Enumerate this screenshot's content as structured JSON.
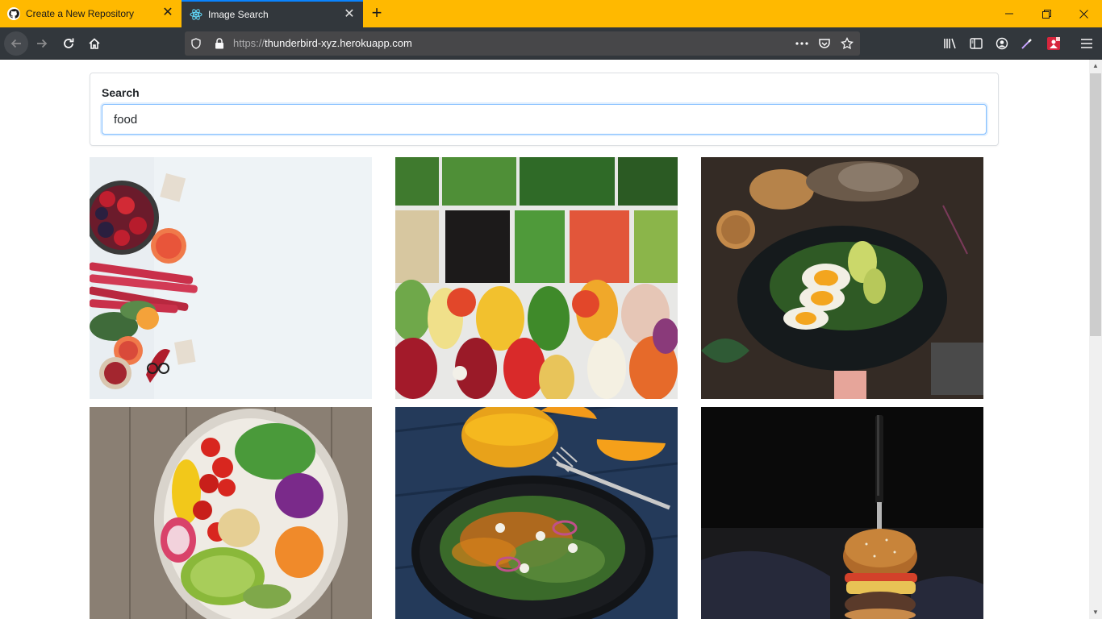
{
  "browser": {
    "tabs": [
      {
        "title": "Create a New Repository",
        "icon": "github-icon"
      },
      {
        "title": "Image Search",
        "icon": "react-icon",
        "active": true
      }
    ],
    "url_scheme": "https://",
    "url_host": "thunderbird-xyz.herokuapp.com",
    "accent_color": "#ffb900"
  },
  "search": {
    "label": "Search",
    "value": "food"
  },
  "results": [
    {
      "subject": "fruits-vegetables-white-background"
    },
    {
      "subject": "salad-bar-bowls"
    },
    {
      "subject": "eggs-avocado-on-slate"
    },
    {
      "subject": "vegetable-buddha-bowl"
    },
    {
      "subject": "salad-plate-orange-juice"
    },
    {
      "subject": "burger-with-knife"
    }
  ]
}
